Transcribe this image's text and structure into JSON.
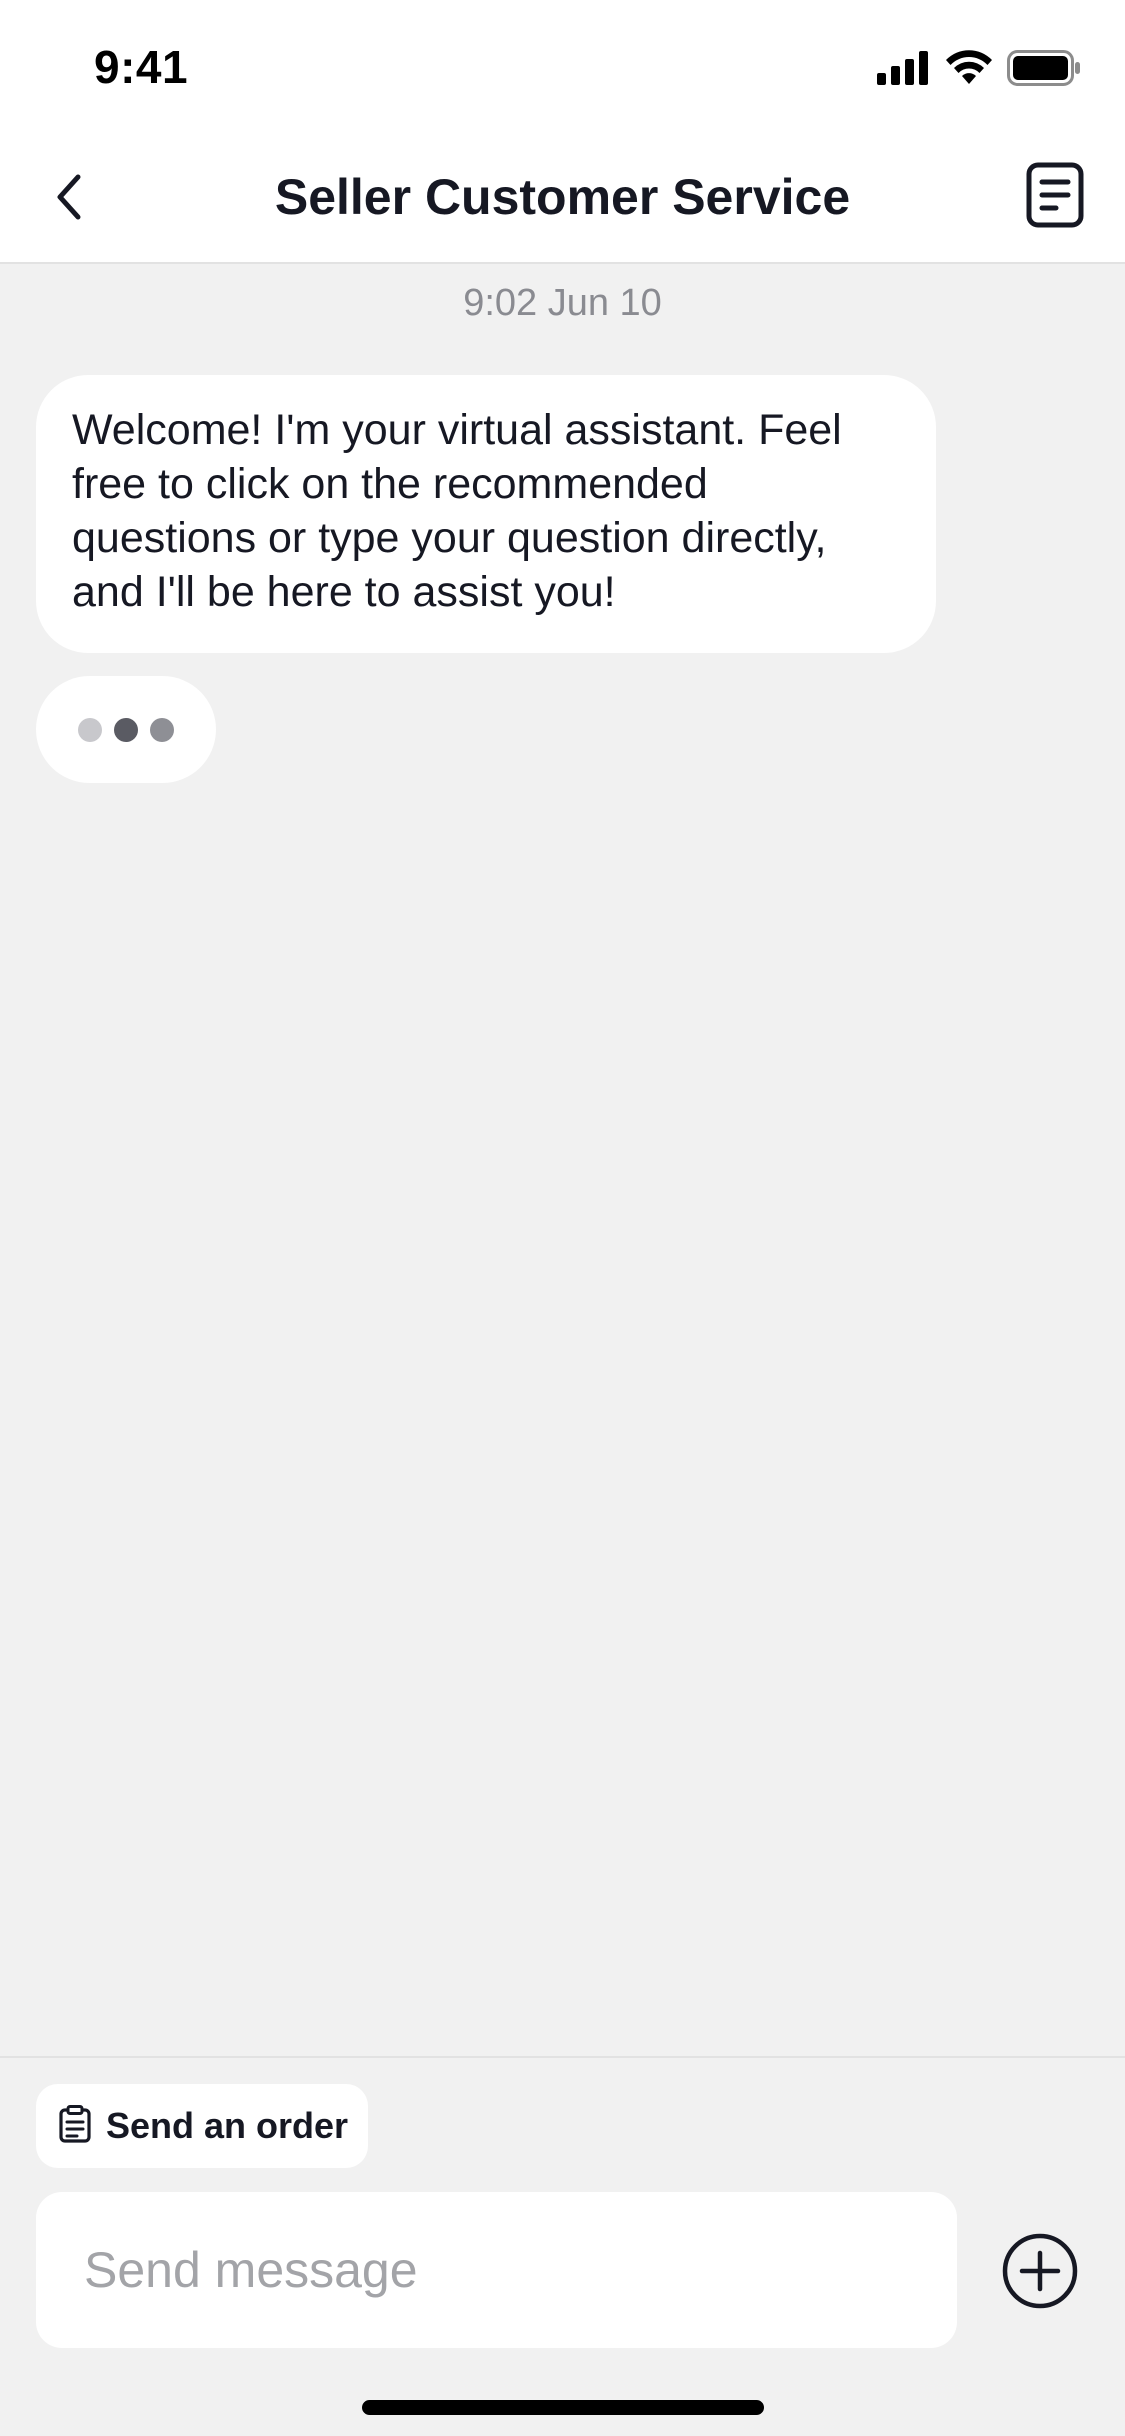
{
  "status_bar": {
    "time": "9:41",
    "icons": [
      "cellular-signal-icon",
      "wifi-icon",
      "battery-icon"
    ]
  },
  "nav": {
    "title": "Seller Customer Service",
    "back_icon": "chevron-left-icon",
    "right_icon": "document-list-icon"
  },
  "chat": {
    "timestamp": "9:02 Jun 10",
    "messages": [
      {
        "sender": "assistant",
        "text": "Welcome! I'm your virtual assistant. Feel free to click on the recommended questions or type your question directly, and I'll be here to assist you!"
      }
    ],
    "typing_indicator": {
      "dot_colors": [
        "#c8c8cc",
        "#5a5b63",
        "#8e8f95"
      ]
    }
  },
  "composer": {
    "send_order_label": "Send an order",
    "send_order_icon": "clipboard-icon",
    "input_placeholder": "Send message",
    "input_value": "",
    "plus_icon": "plus-circle-icon"
  },
  "colors": {
    "background": "#f1f1f1",
    "surface": "#ffffff",
    "text_primary": "#161823",
    "text_secondary": "#8a8b91",
    "placeholder": "#a3a4a8"
  }
}
